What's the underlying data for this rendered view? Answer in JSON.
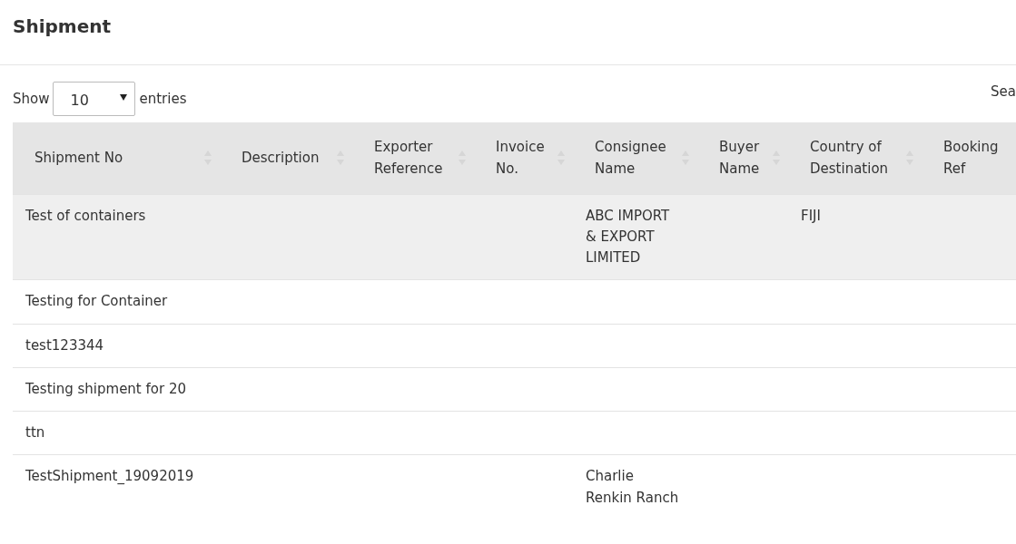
{
  "page_title": "Shipment",
  "length_menu": {
    "prefix": "Show",
    "value": "10",
    "suffix": "entries"
  },
  "search_label": "Sea",
  "table": {
    "columns": [
      {
        "label": "Shipment No"
      },
      {
        "label": "Description"
      },
      {
        "label": "Exporter Reference"
      },
      {
        "label": "Invoice No."
      },
      {
        "label": "Consignee Name"
      },
      {
        "label": "Buyer Name"
      },
      {
        "label": "Country of Destination"
      },
      {
        "label": "Booking Ref"
      }
    ],
    "rows": [
      {
        "selected": true,
        "cells": [
          "Test of containers",
          null,
          null,
          null,
          "ABC IMPORT & EXPORT LIMITED",
          null,
          "FIJI",
          null
        ]
      },
      {
        "selected": false,
        "cells": [
          "Testing for Container",
          null,
          null,
          null,
          null,
          null,
          null,
          null
        ]
      },
      {
        "selected": false,
        "cells": [
          "test123344",
          null,
          null,
          null,
          null,
          null,
          null,
          null
        ]
      },
      {
        "selected": false,
        "cells": [
          "Testing shipment for 20",
          null,
          null,
          null,
          null,
          null,
          null,
          null
        ]
      },
      {
        "selected": false,
        "cells": [
          "ttn",
          null,
          null,
          null,
          null,
          null,
          null,
          null
        ]
      },
      {
        "selected": false,
        "cells": [
          "TestShipment_19092019",
          null,
          null,
          null,
          "Charlie Renkin Ranch",
          null,
          null,
          null
        ]
      }
    ]
  }
}
